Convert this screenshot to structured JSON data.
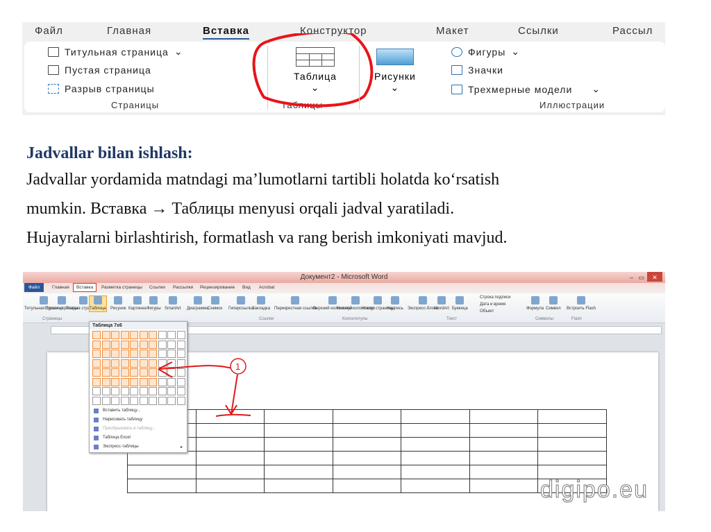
{
  "top_ribbon": {
    "tabs": [
      "Файл",
      "Главная",
      "Вставка",
      "Конструктор",
      "Макет",
      "Ссылки",
      "Рассыл"
    ],
    "active_tab": "Вставка",
    "pages_group": {
      "items": [
        "Титульная страница",
        "Пустая страница",
        "Разрыв страницы"
      ],
      "label": "Страницы"
    },
    "tables_group": {
      "button": "Таблица",
      "label": "Таблицы"
    },
    "pictures_button": "Рисунки",
    "illustrations_group": {
      "items": [
        "Фигуры",
        "Значки",
        "Трехмерные модели"
      ],
      "label": "Иллюстрации"
    },
    "highlight_color": "#e8141b"
  },
  "text": {
    "heading": "Jadvallar bilan ishlash:",
    "lines": [
      "Jadvallar yordamida matndagi ma’lumotlarni tartibli holatda ko‘rsatish",
      "mumkin. Вставка → Таблицы menyusi orqali jadval yaratiladi.",
      "Hujayralarni birlashtirish, formatlash va rang berish imkoniyati mavjud."
    ]
  },
  "word": {
    "title": "Документ2 - Microsoft Word",
    "tabs": [
      "Файл",
      "Главная",
      "Вставка",
      "Разметка страницы",
      "Ссылки",
      "Рассылки",
      "Рецензирование",
      "Вид",
      "Acrobat"
    ],
    "buttons": [
      "Титульная страница",
      "Пустая страница",
      "Разрыв страницы",
      "Таблица",
      "Рисунок",
      "Картинка",
      "Фигуры",
      "SmartArt",
      "Диаграмма",
      "Снимок",
      "Гиперссылка",
      "Закладка",
      "Перекрестная ссылка",
      "Верхний колонтитул",
      "Нижний колонтитул",
      "Номер страницы",
      "Надпись",
      "Экспресс-блоки",
      "WordArt",
      "Буквица",
      "Формула",
      "Символ",
      "Встроить Flash"
    ],
    "small_buttons": [
      "Строка подписи",
      "Дата и время",
      "Объект"
    ],
    "groups": [
      "Страницы",
      "Ссылки",
      "Колонтитулы",
      "Текст",
      "Символы",
      "Flash"
    ],
    "dropdown": {
      "header": "Таблица 7x6",
      "grid_cols": 10,
      "grid_rows": 8,
      "selected_cols": 7,
      "selected_rows": 6,
      "items": [
        {
          "label": "Вставить таблицу...",
          "disabled": false
        },
        {
          "label": "Нарисовать таблицу",
          "disabled": false
        },
        {
          "label": "Преобразовать в таблицу...",
          "disabled": true
        },
        {
          "label": "Таблица Excel",
          "disabled": false
        },
        {
          "label": "Экспресс-таблицы",
          "disabled": false
        }
      ]
    },
    "annotation": "1",
    "table": {
      "cols": 7,
      "rows": 6
    },
    "watermark": "digipo.eu"
  }
}
